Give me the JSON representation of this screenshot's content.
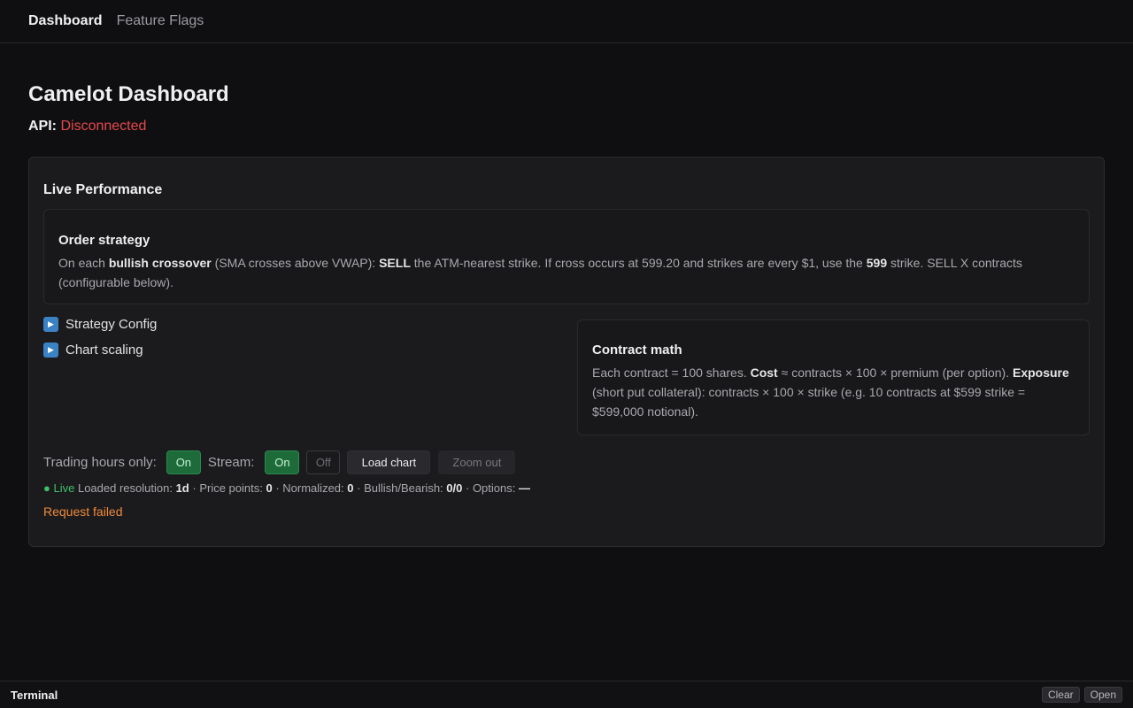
{
  "nav": {
    "items": [
      {
        "label": "Dashboard",
        "active": true
      },
      {
        "label": "Feature Flags",
        "active": false
      }
    ]
  },
  "page": {
    "title": "Camelot Dashboard",
    "api_label": "API:",
    "api_status": "Disconnected",
    "api_status_color": "#e5484d"
  },
  "panel": {
    "title": "Live Performance",
    "order_card": {
      "title": "Order strategy",
      "t1": "On each ",
      "b1": "bullish crossover",
      "t2": " (SMA crosses above VWAP): ",
      "b2": "SELL",
      "t3": " the ATM-nearest strike. If cross occurs at 599.20 and strikes are every $1, use the ",
      "b3": "599",
      "t4": " strike. SELL X contracts (configurable below)."
    },
    "toggles": [
      {
        "icon": "play-icon",
        "label": "Strategy Config"
      },
      {
        "icon": "play-icon",
        "label": "Chart scaling"
      }
    ],
    "math_card": {
      "title": "Contract math",
      "t1": "Each contract = 100 shares. ",
      "b1": "Cost",
      "t2": " ≈ contracts × 100 × premium (per option). ",
      "b2": "Exposure",
      "t3": " (short put collateral): contracts × 100 × strike (e.g. 10 contracts at $599 strike = $599,000 notional)."
    },
    "controls": {
      "trading_hours_label": "Trading hours only:",
      "trading_hours_on": "On",
      "stream_label": "Stream:",
      "stream_on": "On",
      "stream_off": "Off",
      "load_chart": "Load chart",
      "zoom_out": "Zoom out"
    },
    "status": {
      "live_dot": "●",
      "live": "Live",
      "resolution_label": "Loaded resolution:",
      "resolution": "1d",
      "price_points_label": "· Price points:",
      "price_points": "0",
      "normalized_label": "· Normalized:",
      "normalized": "0",
      "bull_bear_label": "· Bullish/Bearish:",
      "bull_bear": "0/0",
      "options_label": "· Options:",
      "options": "—"
    },
    "error": "Request failed"
  },
  "terminal": {
    "title": "Terminal",
    "clear": "Clear",
    "open": "Open"
  },
  "colors": {
    "background": "#0f0f11",
    "accent_green": "#1e6b3a",
    "live_green": "#3fbf6a",
    "error_orange": "#f08a3a",
    "toggle_blue": "#3b82c4"
  }
}
